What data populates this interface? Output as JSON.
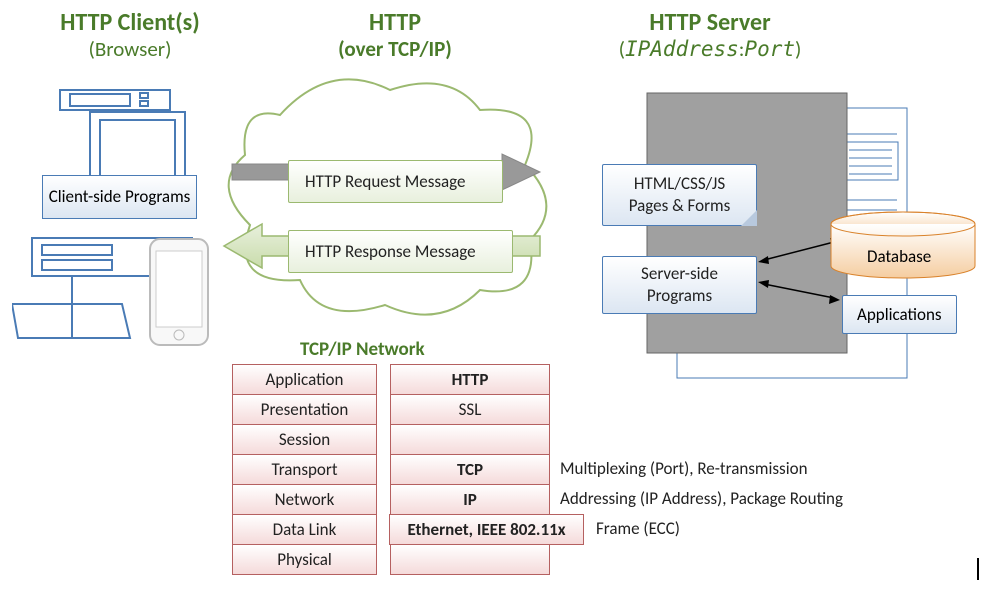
{
  "titles": {
    "client": "HTTP Client(s)",
    "client_sub": "(Browser)",
    "http": "HTTP",
    "http_sub": "(over TCP/IP)",
    "server": "HTTP Server",
    "server_sub_prefix": "(",
    "server_sub_addr": "IPAddress",
    "server_sub_sep": ":",
    "server_sub_port": "Port",
    "server_sub_suffix": ")"
  },
  "client_box": "Client-side Programs",
  "cloud": {
    "request": "HTTP Request Message",
    "response": "HTTP Response Message"
  },
  "server": {
    "pages": "HTML/CSS/JS Pages & Forms",
    "programs": "Server-side Programs"
  },
  "db_label": "Database",
  "apps_label": "Applications",
  "tcp_title": "TCP/IP Network",
  "layers": [
    "Application",
    "Presentation",
    "Session",
    "Transport",
    "Network",
    "Data Link",
    "Physical"
  ],
  "protocols": {
    "l0": "HTTP",
    "l1": "SSL",
    "l2": "",
    "l3": "TCP",
    "l4": "IP",
    "l5": "Ethernet, IEEE 802.11x",
    "l6": ""
  },
  "annotations": {
    "transport": "Multiplexing (Port), Re-transmission",
    "network": "Addressing (IP Address), Package Routing",
    "data_link": "Frame (ECC)"
  }
}
